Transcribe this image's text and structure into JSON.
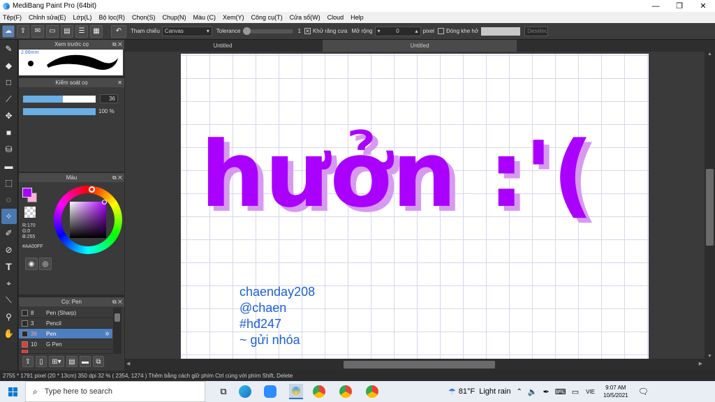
{
  "window": {
    "title": "MediBang Paint Pro (64bit)",
    "minimize": "—",
    "maximize": "❐",
    "close": "✕"
  },
  "menu": [
    "Tệp(F)",
    "Chỉnh sửa(E)",
    "Lớp(L)",
    "Bộ lọc(R)",
    "Chọn(S)",
    "Chụp(N)",
    "Màu (C)",
    "Xem(Y)",
    "Công cụ(T)",
    "Cửa sổ(W)",
    "Cloud",
    "Help"
  ],
  "toolbar": {
    "reference_label": "Tham chiếu",
    "reference_value": "Canvas",
    "tolerance_label": "Tolerance",
    "tolerance_value": "1",
    "antialias_label": "Khử răng cưa",
    "expand_label": "Mở rộng",
    "expand_value": "0",
    "expand_unit": "pixel",
    "close_gap_label": "Đóng khe hở",
    "deselect_label": "Deselec"
  },
  "panels": {
    "brush_preview": {
      "title": "Xem trước cọ",
      "size_label": "2.66mm"
    },
    "brush_control": {
      "title": "Kiểm soát cọ",
      "size_value": "36",
      "size_fill": 0.55,
      "opacity_value": "100 %",
      "opacity_fill": 1.0
    },
    "color": {
      "title": "Màu",
      "r": "R:170",
      "g": "G:0",
      "b": "B:255",
      "hex": "#AA00FF",
      "fg": "#aa00ff",
      "bg": "#ffb3d1"
    },
    "brush_list": {
      "title": "Cọ: Pen",
      "items": [
        {
          "size": "8",
          "name": "Pen (Sharp)",
          "swatch": "#2a2a2a"
        },
        {
          "size": "3",
          "name": "Pencil",
          "swatch": "#2a2a2a"
        },
        {
          "size": "36",
          "name": "Pen",
          "swatch": "#2a2a2a"
        },
        {
          "size": "10",
          "name": "G Pen",
          "swatch": "#e53935"
        },
        {
          "size": "",
          "name": "",
          "swatch": "#e53935"
        }
      ]
    }
  },
  "tabs": [
    "Untitled",
    "Untitled"
  ],
  "canvas": {
    "artwork_text": "hưởn :'( ",
    "artwork_color": "#aa00ff",
    "signature": [
      "chaenday208",
      "@chaen",
      "#hđ247",
      "~ gửi nhóa"
    ]
  },
  "status": {
    "size": "2755 * 1791 pixel",
    "cm": "(20 * 13cm)",
    "dpi": "350 dpi",
    "zoom": "32 %",
    "coords": "( 2354, 1274 )",
    "hint": "Thêm bằng cách giữ phím Ctrl cùng với phím Shift, Delete"
  },
  "taskbar": {
    "search_placeholder": "Type here to search",
    "weather": "81°F  Light rain",
    "lang": "VIE",
    "time": "9:07 AM",
    "date": "10/5/2021"
  }
}
